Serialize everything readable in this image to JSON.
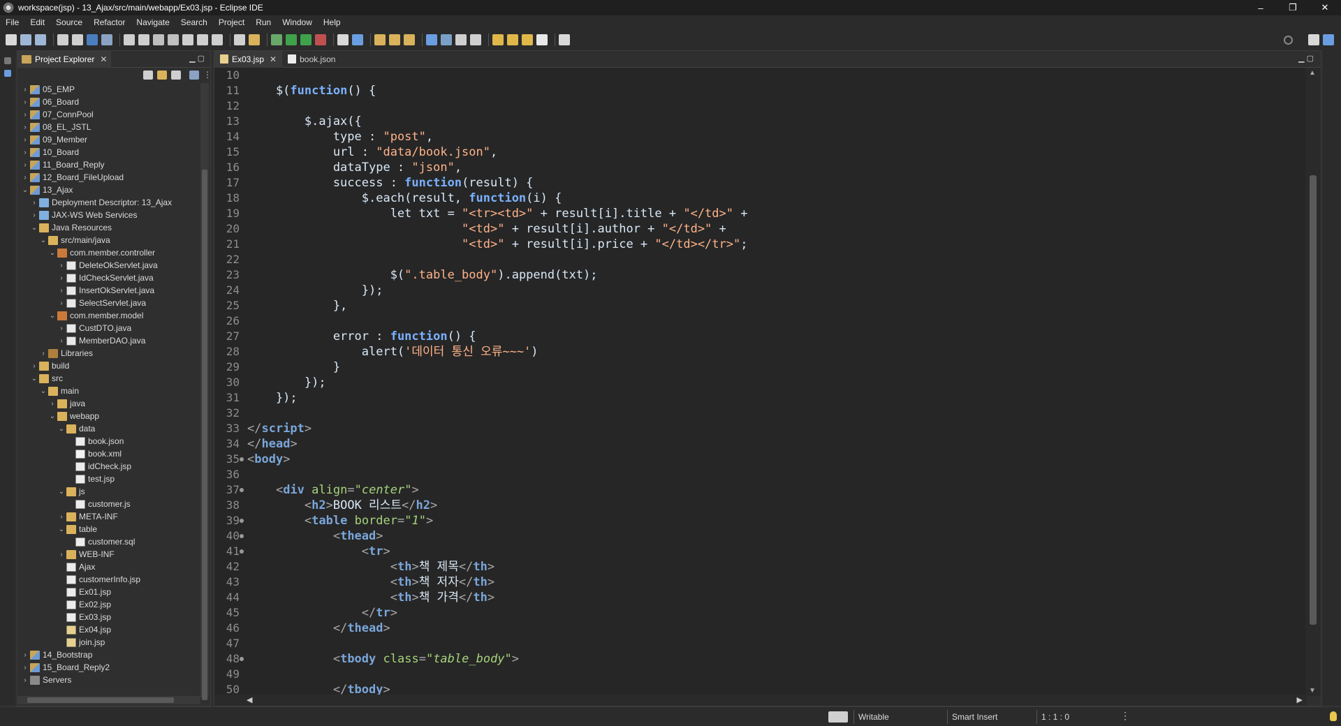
{
  "window": {
    "title": "workspace(jsp) - 13_Ajax/src/main/webapp/Ex03.jsp - Eclipse IDE",
    "controls": {
      "minimize": "–",
      "restore": "❐",
      "close": "✕"
    }
  },
  "menu": [
    "File",
    "Edit",
    "Source",
    "Refactor",
    "Navigate",
    "Search",
    "Project",
    "Run",
    "Window",
    "Help"
  ],
  "project_explorer": {
    "title": "Project Explorer",
    "close": "✕",
    "tree": [
      {
        "label": "05_EMP",
        "depth": 0,
        "expander": "›",
        "icon": "project-icon"
      },
      {
        "label": "06_Board",
        "depth": 0,
        "expander": "›",
        "icon": "project-icon"
      },
      {
        "label": "07_ConnPool",
        "depth": 0,
        "expander": "›",
        "icon": "project-icon"
      },
      {
        "label": "08_EL_JSTL",
        "depth": 0,
        "expander": "›",
        "icon": "project-icon"
      },
      {
        "label": "09_Member",
        "depth": 0,
        "expander": "›",
        "icon": "project-icon"
      },
      {
        "label": "10_Board",
        "depth": 0,
        "expander": "›",
        "icon": "project-icon"
      },
      {
        "label": "11_Board_Reply",
        "depth": 0,
        "expander": "›",
        "icon": "project-icon"
      },
      {
        "label": "12_Board_FileUpload",
        "depth": 0,
        "expander": "›",
        "icon": "project-icon"
      },
      {
        "label": "13_Ajax",
        "depth": 0,
        "expander": "⌄",
        "icon": "project-icon"
      },
      {
        "label": "Deployment Descriptor: 13_Ajax",
        "depth": 1,
        "expander": "›",
        "icon": "descriptor-icon"
      },
      {
        "label": "JAX-WS Web Services",
        "depth": 1,
        "expander": "›",
        "icon": "webservice-icon"
      },
      {
        "label": "Java Resources",
        "depth": 1,
        "expander": "⌄",
        "icon": "folder-icon"
      },
      {
        "label": "src/main/java",
        "depth": 2,
        "expander": "⌄",
        "icon": "folder-icon"
      },
      {
        "label": "com.member.controller",
        "depth": 3,
        "expander": "⌄",
        "icon": "package-icon"
      },
      {
        "label": "DeleteOkServlet.java",
        "depth": 4,
        "expander": "›",
        "icon": "java-file-icon"
      },
      {
        "label": "IdCheckServlet.java",
        "depth": 4,
        "expander": "›",
        "icon": "java-file-icon"
      },
      {
        "label": "InsertOkServlet.java",
        "depth": 4,
        "expander": "›",
        "icon": "java-file-icon"
      },
      {
        "label": "SelectServlet.java",
        "depth": 4,
        "expander": "›",
        "icon": "java-file-icon"
      },
      {
        "label": "com.member.model",
        "depth": 3,
        "expander": "⌄",
        "icon": "package-icon"
      },
      {
        "label": "CustDTO.java",
        "depth": 4,
        "expander": "›",
        "icon": "java-file-icon"
      },
      {
        "label": "MemberDAO.java",
        "depth": 4,
        "expander": "›",
        "icon": "java-file-icon"
      },
      {
        "label": "Libraries",
        "depth": 2,
        "expander": "›",
        "icon": "library-icon"
      },
      {
        "label": "build",
        "depth": 1,
        "expander": "›",
        "icon": "folder-icon"
      },
      {
        "label": "src",
        "depth": 1,
        "expander": "⌄",
        "icon": "folder-icon"
      },
      {
        "label": "main",
        "depth": 2,
        "expander": "⌄",
        "icon": "folder-icon"
      },
      {
        "label": "java",
        "depth": 3,
        "expander": "›",
        "icon": "folder-icon"
      },
      {
        "label": "webapp",
        "depth": 3,
        "expander": "⌄",
        "icon": "folder-icon"
      },
      {
        "label": "data",
        "depth": 4,
        "expander": "⌄",
        "icon": "folder-icon"
      },
      {
        "label": "book.json",
        "depth": 5,
        "expander": "",
        "icon": "file-icon"
      },
      {
        "label": "book.xml",
        "depth": 5,
        "expander": "",
        "icon": "xml-file-icon"
      },
      {
        "label": "idCheck.jsp",
        "depth": 5,
        "expander": "",
        "icon": "file-icon"
      },
      {
        "label": "test.jsp",
        "depth": 5,
        "expander": "",
        "icon": "file-icon"
      },
      {
        "label": "js",
        "depth": 4,
        "expander": "⌄",
        "icon": "folder-icon"
      },
      {
        "label": "customer.js",
        "depth": 5,
        "expander": "",
        "icon": "file-icon"
      },
      {
        "label": "META-INF",
        "depth": 4,
        "expander": "›",
        "icon": "folder-icon"
      },
      {
        "label": "table",
        "depth": 4,
        "expander": "⌄",
        "icon": "folder-icon"
      },
      {
        "label": "customer.sql",
        "depth": 5,
        "expander": "",
        "icon": "file-icon"
      },
      {
        "label": "WEB-INF",
        "depth": 4,
        "expander": "›",
        "icon": "folder-icon"
      },
      {
        "label": "Ajax",
        "depth": 4,
        "expander": "",
        "icon": "file-icon"
      },
      {
        "label": "customerInfo.jsp",
        "depth": 4,
        "expander": "",
        "icon": "file-icon"
      },
      {
        "label": "Ex01.jsp",
        "depth": 4,
        "expander": "",
        "icon": "file-icon"
      },
      {
        "label": "Ex02.jsp",
        "depth": 4,
        "expander": "",
        "icon": "file-icon"
      },
      {
        "label": "Ex03.jsp",
        "depth": 4,
        "expander": "",
        "icon": "file-icon"
      },
      {
        "label": "Ex04.jsp",
        "depth": 4,
        "expander": "",
        "icon": "jsp-file-icon"
      },
      {
        "label": "join.jsp",
        "depth": 4,
        "expander": "",
        "icon": "jsp-file-icon"
      },
      {
        "label": "14_Bootstrap",
        "depth": 0,
        "expander": "›",
        "icon": "project-icon"
      },
      {
        "label": "15_Board_Reply2",
        "depth": 0,
        "expander": "›",
        "icon": "project-icon"
      },
      {
        "label": "Servers",
        "depth": 0,
        "expander": "›",
        "icon": "server-icon"
      }
    ]
  },
  "editor": {
    "tabs": [
      {
        "label": "Ex03.jsp",
        "active": true,
        "closable": "✕"
      },
      {
        "label": "book.json",
        "active": false,
        "closable": ""
      }
    ],
    "lines": [
      {
        "n": "10",
        "fold": false,
        "tokens": []
      },
      {
        "n": "11",
        "fold": false,
        "tokens": [
          [
            "p",
            "    $("
          ],
          [
            "f",
            "function"
          ],
          [
            "p",
            "() {"
          ]
        ]
      },
      {
        "n": "12",
        "fold": false,
        "tokens": []
      },
      {
        "n": "13",
        "fold": false,
        "tokens": [
          [
            "p",
            "        $.ajax({"
          ]
        ]
      },
      {
        "n": "14",
        "fold": false,
        "tokens": [
          [
            "p",
            "            type : "
          ],
          [
            "s",
            "\"post\""
          ],
          [
            "p",
            ","
          ]
        ]
      },
      {
        "n": "15",
        "fold": false,
        "tokens": [
          [
            "p",
            "            url : "
          ],
          [
            "s",
            "\"data/book.json\""
          ],
          [
            "p",
            ","
          ]
        ]
      },
      {
        "n": "16",
        "fold": false,
        "tokens": [
          [
            "p",
            "            dataType : "
          ],
          [
            "s",
            "\"json\""
          ],
          [
            "p",
            ","
          ]
        ]
      },
      {
        "n": "17",
        "fold": false,
        "tokens": [
          [
            "p",
            "            success : "
          ],
          [
            "f",
            "function"
          ],
          [
            "p",
            "(result) {"
          ]
        ]
      },
      {
        "n": "18",
        "fold": false,
        "tokens": [
          [
            "p",
            "                $.each(result, "
          ],
          [
            "f",
            "function"
          ],
          [
            "p",
            "(i) {"
          ]
        ]
      },
      {
        "n": "19",
        "fold": false,
        "tokens": [
          [
            "p",
            "                    let txt = "
          ],
          [
            "s",
            "\"<tr><td>\""
          ],
          [
            "p",
            " + result[i].title + "
          ],
          [
            "s",
            "\"</td>\""
          ],
          [
            "p",
            " +"
          ]
        ]
      },
      {
        "n": "20",
        "fold": false,
        "tokens": [
          [
            "p",
            "                              "
          ],
          [
            "s",
            "\"<td>\""
          ],
          [
            "p",
            " + result[i].author + "
          ],
          [
            "s",
            "\"</td>\""
          ],
          [
            "p",
            " +"
          ]
        ]
      },
      {
        "n": "21",
        "fold": false,
        "tokens": [
          [
            "p",
            "                              "
          ],
          [
            "s",
            "\"<td>\""
          ],
          [
            "p",
            " + result[i].price + "
          ],
          [
            "s",
            "\"</td></tr>\""
          ],
          [
            "p",
            ";"
          ]
        ]
      },
      {
        "n": "22",
        "fold": false,
        "tokens": []
      },
      {
        "n": "23",
        "fold": false,
        "tokens": [
          [
            "p",
            "                    $("
          ],
          [
            "s",
            "\".table_body\""
          ],
          [
            "p",
            ").append(txt);"
          ]
        ]
      },
      {
        "n": "24",
        "fold": false,
        "tokens": [
          [
            "p",
            "                });"
          ]
        ]
      },
      {
        "n": "25",
        "fold": false,
        "tokens": [
          [
            "p",
            "            },"
          ]
        ]
      },
      {
        "n": "26",
        "fold": false,
        "tokens": []
      },
      {
        "n": "27",
        "fold": false,
        "tokens": [
          [
            "p",
            "            error : "
          ],
          [
            "f",
            "function"
          ],
          [
            "p",
            "() {"
          ]
        ]
      },
      {
        "n": "28",
        "fold": false,
        "tokens": [
          [
            "p",
            "                alert("
          ],
          [
            "s",
            "'데이터 통신 오류~~~'"
          ],
          [
            "p",
            ")"
          ]
        ]
      },
      {
        "n": "29",
        "fold": false,
        "tokens": [
          [
            "p",
            "            }"
          ]
        ]
      },
      {
        "n": "30",
        "fold": false,
        "tokens": [
          [
            "p",
            "        });"
          ]
        ]
      },
      {
        "n": "31",
        "fold": false,
        "tokens": [
          [
            "p",
            "    });"
          ]
        ]
      },
      {
        "n": "32",
        "fold": false,
        "tokens": []
      },
      {
        "n": "33",
        "fold": false,
        "tokens": [
          [
            "b",
            "</"
          ],
          [
            "t",
            "script"
          ],
          [
            "b",
            ">"
          ]
        ]
      },
      {
        "n": "34",
        "fold": false,
        "tokens": [
          [
            "b",
            "</"
          ],
          [
            "t",
            "head"
          ],
          [
            "b",
            ">"
          ]
        ]
      },
      {
        "n": "35",
        "fold": true,
        "tokens": [
          [
            "b",
            "<"
          ],
          [
            "t",
            "body"
          ],
          [
            "b",
            ">"
          ]
        ]
      },
      {
        "n": "36",
        "fold": false,
        "tokens": []
      },
      {
        "n": "37",
        "fold": true,
        "tokens": [
          [
            "p",
            "    "
          ],
          [
            "b",
            "<"
          ],
          [
            "t",
            "div"
          ],
          [
            "p",
            " "
          ],
          [
            "a",
            "align"
          ],
          [
            "b",
            "="
          ],
          [
            "v",
            "\"center\""
          ],
          [
            "b",
            ">"
          ]
        ]
      },
      {
        "n": "38",
        "fold": false,
        "tokens": [
          [
            "p",
            "        "
          ],
          [
            "b",
            "<"
          ],
          [
            "t",
            "h2"
          ],
          [
            "b",
            ">"
          ],
          [
            "p",
            "BOOK 리스트"
          ],
          [
            "b",
            "</"
          ],
          [
            "t",
            "h2"
          ],
          [
            "b",
            ">"
          ]
        ]
      },
      {
        "n": "39",
        "fold": true,
        "tokens": [
          [
            "p",
            "        "
          ],
          [
            "b",
            "<"
          ],
          [
            "t",
            "table"
          ],
          [
            "p",
            " "
          ],
          [
            "a",
            "border"
          ],
          [
            "b",
            "="
          ],
          [
            "v",
            "\"1\""
          ],
          [
            "b",
            ">"
          ]
        ]
      },
      {
        "n": "40",
        "fold": true,
        "tokens": [
          [
            "p",
            "            "
          ],
          [
            "b",
            "<"
          ],
          [
            "t",
            "thead"
          ],
          [
            "b",
            ">"
          ]
        ]
      },
      {
        "n": "41",
        "fold": true,
        "tokens": [
          [
            "p",
            "                "
          ],
          [
            "b",
            "<"
          ],
          [
            "t",
            "tr"
          ],
          [
            "b",
            ">"
          ]
        ]
      },
      {
        "n": "42",
        "fold": false,
        "tokens": [
          [
            "p",
            "                    "
          ],
          [
            "b",
            "<"
          ],
          [
            "t",
            "th"
          ],
          [
            "b",
            ">"
          ],
          [
            "p",
            "책 제목"
          ],
          [
            "b",
            "</"
          ],
          [
            "t",
            "th"
          ],
          [
            "b",
            ">"
          ]
        ]
      },
      {
        "n": "43",
        "fold": false,
        "tokens": [
          [
            "p",
            "                    "
          ],
          [
            "b",
            "<"
          ],
          [
            "t",
            "th"
          ],
          [
            "b",
            ">"
          ],
          [
            "p",
            "책 저자"
          ],
          [
            "b",
            "</"
          ],
          [
            "t",
            "th"
          ],
          [
            "b",
            ">"
          ]
        ]
      },
      {
        "n": "44",
        "fold": false,
        "tokens": [
          [
            "p",
            "                    "
          ],
          [
            "b",
            "<"
          ],
          [
            "t",
            "th"
          ],
          [
            "b",
            ">"
          ],
          [
            "p",
            "책 가격"
          ],
          [
            "b",
            "</"
          ],
          [
            "t",
            "th"
          ],
          [
            "b",
            ">"
          ]
        ]
      },
      {
        "n": "45",
        "fold": false,
        "tokens": [
          [
            "p",
            "                "
          ],
          [
            "b",
            "</"
          ],
          [
            "t",
            "tr"
          ],
          [
            "b",
            ">"
          ]
        ]
      },
      {
        "n": "46",
        "fold": false,
        "tokens": [
          [
            "p",
            "            "
          ],
          [
            "b",
            "</"
          ],
          [
            "t",
            "thead"
          ],
          [
            "b",
            ">"
          ]
        ]
      },
      {
        "n": "47",
        "fold": false,
        "tokens": []
      },
      {
        "n": "48",
        "fold": true,
        "tokens": [
          [
            "p",
            "            "
          ],
          [
            "b",
            "<"
          ],
          [
            "t",
            "tbody"
          ],
          [
            "p",
            " "
          ],
          [
            "a",
            "class"
          ],
          [
            "b",
            "="
          ],
          [
            "v",
            "\"table_body\""
          ],
          [
            "b",
            ">"
          ]
        ]
      },
      {
        "n": "49",
        "fold": false,
        "tokens": []
      },
      {
        "n": "50",
        "fold": false,
        "tokens": [
          [
            "p",
            "            "
          ],
          [
            "b",
            "</"
          ],
          [
            "t",
            "tbody"
          ],
          [
            "b",
            ">"
          ]
        ]
      }
    ]
  },
  "status": {
    "writable": "Writable",
    "insert_mode": "Smart Insert",
    "position": "1 : 1 : 0",
    "more": "⋮"
  },
  "colors": {
    "keyword": "#7ab1ff",
    "string": "#ffb38a",
    "tag": "#7aa6da",
    "attribute": "#a6d37c",
    "background": "#262626"
  }
}
